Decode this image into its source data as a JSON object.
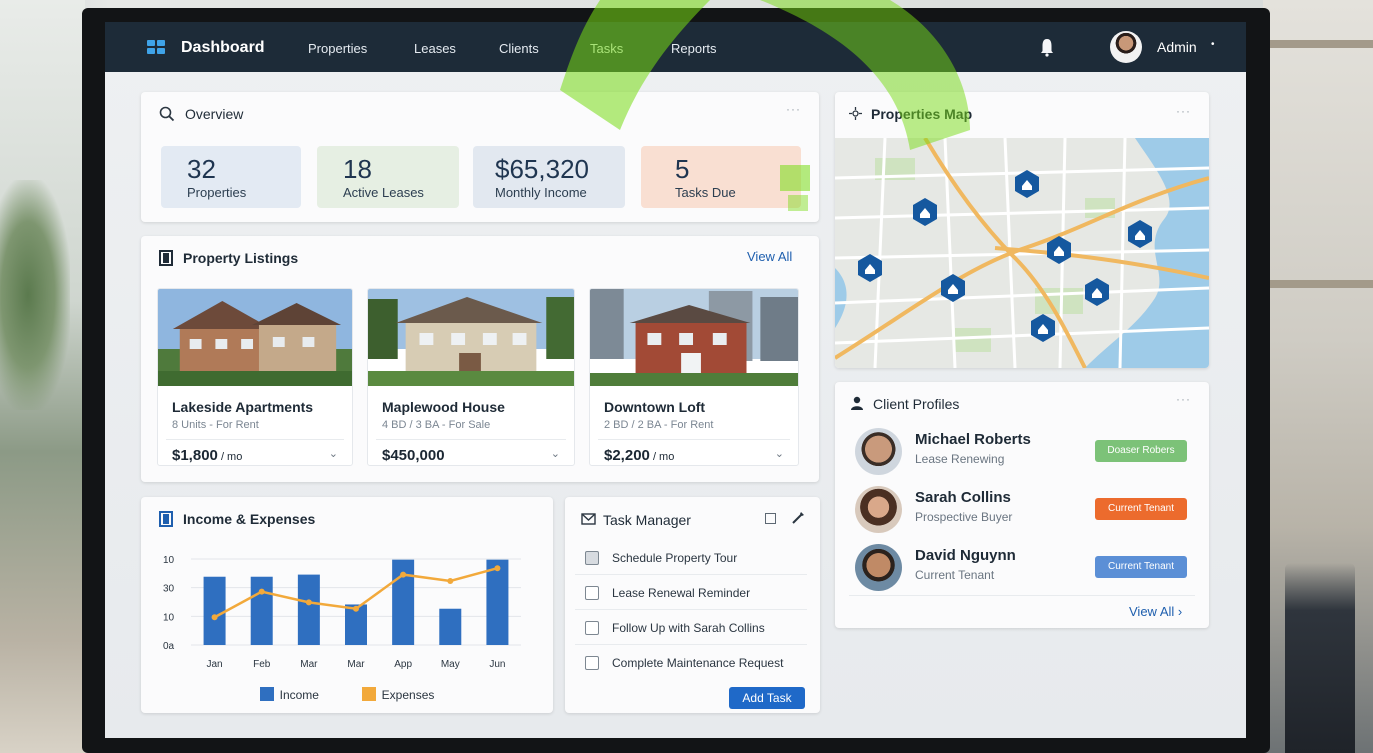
{
  "nav": {
    "brand": "Dashboard",
    "links": [
      "Properties",
      "Leases",
      "Clients",
      "Tasks",
      "Reports"
    ],
    "user": "Admin",
    "user_caret": "•"
  },
  "overview": {
    "title": "Overview",
    "menu": "···",
    "stats": [
      {
        "value": "32",
        "label": "Properties",
        "color": "#e3eaf3"
      },
      {
        "value": "18",
        "label": "Active Leases",
        "color": "#e6efe3"
      },
      {
        "value": "$65,320",
        "label": "Monthly Income",
        "color": "#e2e8f0"
      },
      {
        "value": "5",
        "label": "Tasks Due",
        "color": "#f9dfd2"
      }
    ]
  },
  "listings": {
    "title": "Property Listings",
    "view_all": "View All",
    "items": [
      {
        "name": "Lakeside Apartments",
        "sub": "8 Units - For Rent",
        "price": "$1,800",
        "unit": " / mo"
      },
      {
        "name": "Maplewood House",
        "sub": "4 BD / 3 BA - For Sale",
        "price": "$450,000",
        "unit": ""
      },
      {
        "name": "Downtown Loft",
        "sub": "2 BD / 2 BA - For Rent",
        "price": "$2,200",
        "unit": " / mo"
      }
    ]
  },
  "income": {
    "title": "Income & Expenses",
    "legend": {
      "income": "Income",
      "expenses": "Expenses"
    },
    "colors": {
      "income": "#2f6fc0",
      "expenses": "#f2a93b"
    }
  },
  "chart_data": {
    "type": "bar",
    "title": "Income & Expenses",
    "categories": [
      "Jan",
      "Feb",
      "Mar",
      "Mar",
      "App",
      "May",
      "Jun"
    ],
    "ytick_labels": [
      "10",
      "30",
      "10",
      "0a"
    ],
    "series": [
      {
        "name": "Income",
        "type": "bar",
        "values": [
          32,
          32,
          33,
          19,
          40,
          17,
          40
        ]
      },
      {
        "name": "Expenses",
        "type": "line",
        "values": [
          13,
          25,
          20,
          17,
          33,
          30,
          36
        ]
      }
    ],
    "ylim": [
      0,
      45
    ],
    "grid": true,
    "legend": "bottom"
  },
  "tasks": {
    "title": "Task Manager",
    "items": [
      {
        "label": "Schedule Property Tour",
        "checked": true
      },
      {
        "label": "Lease Renewal Reminder",
        "checked": false
      },
      {
        "label": "Follow Up with Sarah Collins",
        "checked": false
      },
      {
        "label": "Complete Maintenance Request",
        "checked": false
      }
    ],
    "add_label": "Add Task"
  },
  "map": {
    "title": "Properties Map",
    "menu": "···"
  },
  "clients": {
    "title": "Client Profiles",
    "menu": "···",
    "items": [
      {
        "name": "Michael Roberts",
        "status": "Lease Renewing",
        "badge": "Doaser Robers",
        "badge_color": "#7cc278"
      },
      {
        "name": "Sarah Collins",
        "status": "Prospective Buyer",
        "badge": "Current Tenant",
        "badge_color": "#ec6b2d"
      },
      {
        "name": "David Nguynn",
        "status": "Current Tenant",
        "badge": "Current Tenant",
        "badge_color": "#5b8fd6"
      }
    ],
    "view_all": "View All ›"
  }
}
